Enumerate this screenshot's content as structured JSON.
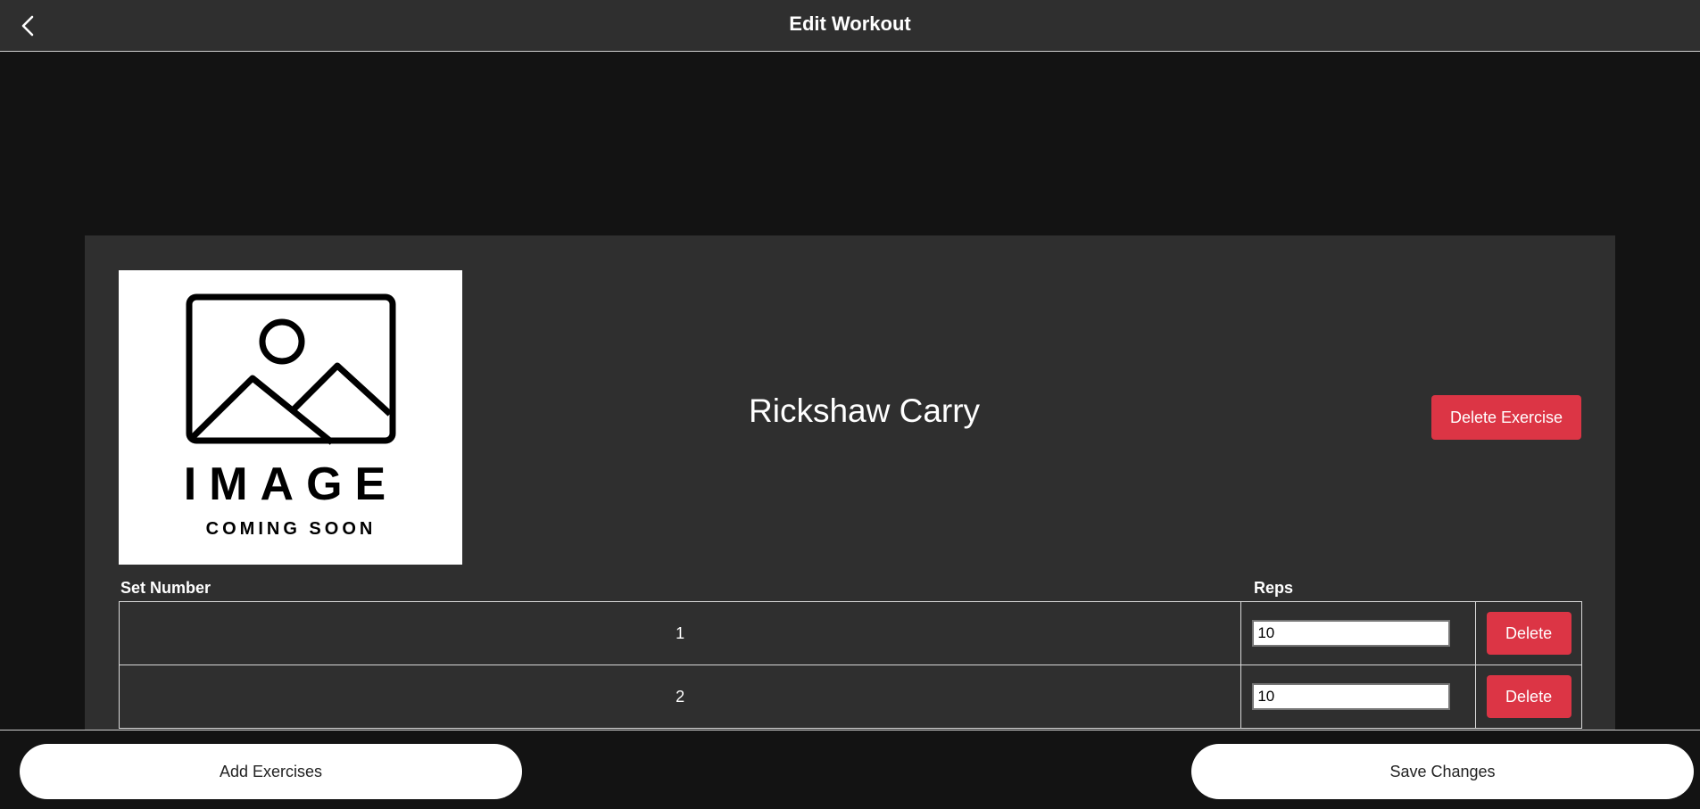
{
  "header": {
    "title": "Edit Workout",
    "back_icon": "chevron-left-icon"
  },
  "exercise": {
    "name": "Rickshaw Carry",
    "image_placeholder": {
      "line1": "IMAGE",
      "line2": "COMING SOON"
    },
    "delete_label": "Delete Exercise",
    "columns": {
      "set_number": "Set Number",
      "reps": "Reps"
    },
    "sets": [
      {
        "set_number": "1",
        "reps": "10",
        "delete_label": "Delete"
      },
      {
        "set_number": "2",
        "reps": "10",
        "delete_label": "Delete"
      }
    ]
  },
  "footer": {
    "add_label": "Add Exercises",
    "save_label": "Save Changes"
  },
  "colors": {
    "danger": "#dc3545",
    "header_bg": "#2f2f2f",
    "page_bg": "#131313"
  }
}
